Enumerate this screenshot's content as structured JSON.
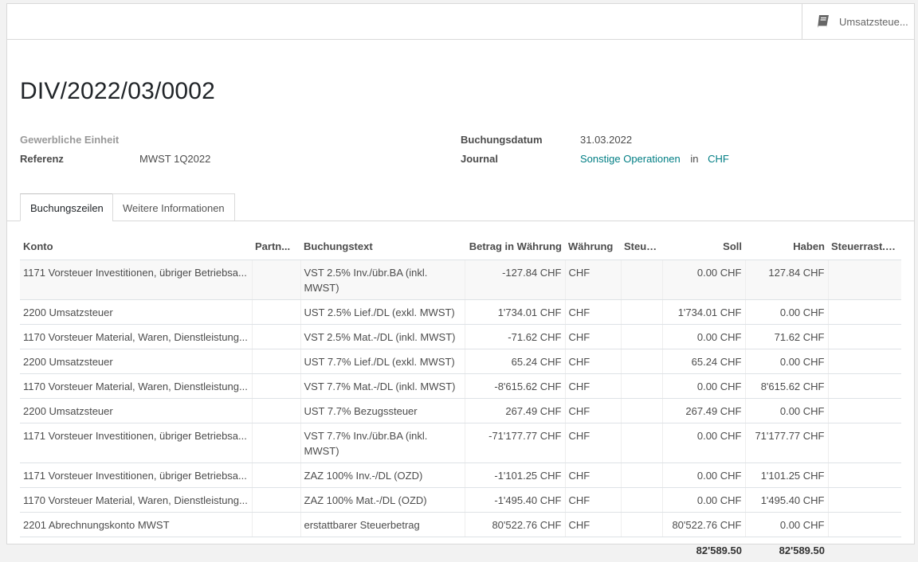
{
  "smart_button": {
    "label": "Umsatzsteue...",
    "icon": "book-icon"
  },
  "title": "DIV/2022/03/0002",
  "fields": {
    "business_unit_label": "Gewerbliche Einheit",
    "reference_label": "Referenz",
    "reference_value": "MWST 1Q2022",
    "date_label": "Buchungsdatum",
    "date_value": "31.03.2022",
    "journal_label": "Journal",
    "journal_value": "Sonstige Operationen",
    "journal_in": "in",
    "journal_currency": "CHF"
  },
  "tabs": [
    "Buchungszeilen",
    "Weitere Informationen"
  ],
  "table": {
    "headers": [
      "Konto",
      "Partn...",
      "Buchungstext",
      "Betrag in Währung",
      "Währung",
      "Steuern",
      "Soll",
      "Haben",
      "Steuerrast..."
    ],
    "rows": [
      [
        "1171 Vorsteuer Investitionen, übriger Betriebsa...",
        "",
        "VST 2.5% Inv./übr.BA (inkl. MWST)",
        "-127.84 CHF",
        "CHF",
        "",
        "0.00 CHF",
        "127.84 CHF",
        ""
      ],
      [
        "2200 Umsatzsteuer",
        "",
        "UST 2.5% Lief./DL (exkl. MWST)",
        "1'734.01 CHF",
        "CHF",
        "",
        "1'734.01 CHF",
        "0.00 CHF",
        ""
      ],
      [
        "1170 Vorsteuer Material, Waren, Dienstleistung...",
        "",
        "VST 2.5% Mat.-/DL (inkl. MWST)",
        "-71.62 CHF",
        "CHF",
        "",
        "0.00 CHF",
        "71.62 CHF",
        ""
      ],
      [
        "2200 Umsatzsteuer",
        "",
        "UST 7.7% Lief./DL (exkl. MWST)",
        "65.24 CHF",
        "CHF",
        "",
        "65.24 CHF",
        "0.00 CHF",
        ""
      ],
      [
        "1170 Vorsteuer Material, Waren, Dienstleistung...",
        "",
        "VST 7.7% Mat.-/DL (inkl. MWST)",
        "-8'615.62 CHF",
        "CHF",
        "",
        "0.00 CHF",
        "8'615.62 CHF",
        ""
      ],
      [
        "2200 Umsatzsteuer",
        "",
        "UST 7.7% Bezugssteuer",
        "267.49 CHF",
        "CHF",
        "",
        "267.49 CHF",
        "0.00 CHF",
        ""
      ],
      [
        "1171 Vorsteuer Investitionen, übriger Betriebsa...",
        "",
        "VST 7.7% Inv./übr.BA (inkl. MWST)",
        "-71'177.77 CHF",
        "CHF",
        "",
        "0.00 CHF",
        "71'177.77 CHF",
        ""
      ],
      [
        "1171 Vorsteuer Investitionen, übriger Betriebsa...",
        "",
        "ZAZ 100% Inv.-/DL (OZD)",
        "-1'101.25 CHF",
        "CHF",
        "",
        "0.00 CHF",
        "1'101.25 CHF",
        ""
      ],
      [
        "1170 Vorsteuer Material, Waren, Dienstleistung...",
        "",
        "ZAZ 100% Mat.-/DL (OZD)",
        "-1'495.40 CHF",
        "CHF",
        "",
        "0.00 CHF",
        "1'495.40 CHF",
        ""
      ],
      [
        "2201 Abrechnungskonto MWST",
        "",
        "erstattbarer Steuerbetrag",
        "80'522.76 CHF",
        "CHF",
        "",
        "80'522.76 CHF",
        "0.00 CHF",
        ""
      ]
    ],
    "totals": {
      "debit": "82'589.50",
      "credit": "82'589.50"
    }
  }
}
